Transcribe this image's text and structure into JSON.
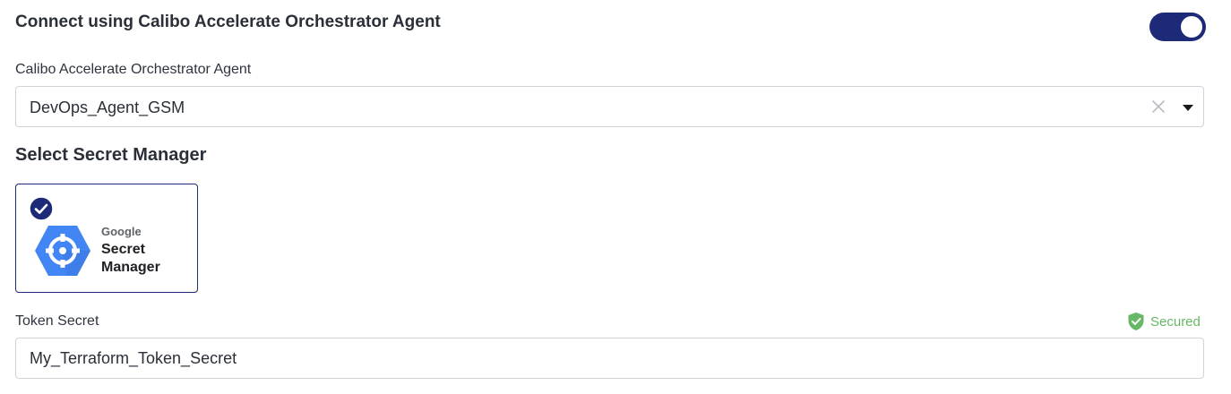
{
  "connect": {
    "title": "Connect using Calibo Accelerate Orchestrator Agent",
    "toggle_on": true,
    "toggle_color": "#1c2a78"
  },
  "agent": {
    "label": "Calibo Accelerate Orchestrator Agent",
    "value": "DevOps_Agent_GSM",
    "clear_icon": "close-icon",
    "caret_icon": "caret-down-icon"
  },
  "secret_manager": {
    "title": "Select Secret Manager",
    "selected": true,
    "options": [
      {
        "brand": "Google",
        "product_line1": "Secret",
        "product_line2": "Manager",
        "icon": "google-secret-manager-logo",
        "brand_color": "#4285f4"
      }
    ]
  },
  "token": {
    "label": "Token Secret",
    "status": "Secured",
    "status_icon": "shield-check-icon",
    "status_color": "#67b866",
    "value": "My_Terraform_Token_Secret"
  }
}
